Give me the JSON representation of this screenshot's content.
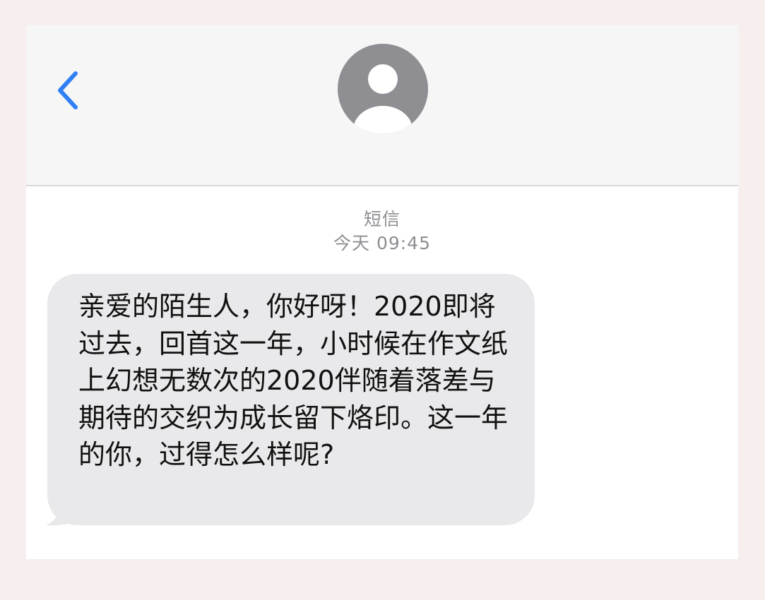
{
  "header": {
    "back_icon": "chevron-left-icon",
    "avatar_icon": "person-avatar-icon",
    "accent_color": "#2f7ff5"
  },
  "thread": {
    "service_label": "短信",
    "timestamp": "今天 09:45"
  },
  "message": {
    "text": "亲爱的陌生人，你好呀！2020即将过去，回首这一年，小时候在作文纸上幻想无数次的2020伴随着落差与期待的交织为成长留下烙印。这一年的你，过得怎么样呢?",
    "bubble_color": "#e9e9eb"
  }
}
